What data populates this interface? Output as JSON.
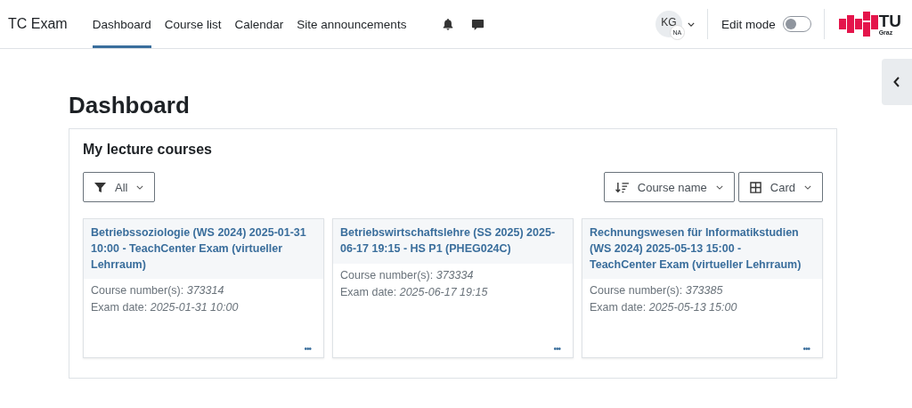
{
  "site_name": "TC Exam",
  "nav": [
    {
      "label": "Dashboard",
      "selected": true
    },
    {
      "label": "Course list",
      "selected": false
    },
    {
      "label": "Calendar",
      "selected": false
    },
    {
      "label": "Site announcements",
      "selected": false
    }
  ],
  "user": {
    "initials": "KG",
    "badge": "NA"
  },
  "edit_mode": {
    "label": "Edit mode",
    "on": false
  },
  "logo": {
    "text": "TU",
    "subtext": "Graz"
  },
  "page_title": "Dashboard",
  "block": {
    "title": "My lecture courses",
    "filter": "All",
    "sort": "Course name",
    "view": "Card",
    "courses": [
      {
        "title": "Betriebssoziologie (WS 2024) 2025-01-31 10:00 - TeachCenter Exam (virtueller Lehrraum)",
        "number": "Course number(s): *373314*",
        "date": "Exam date: *2025-01-31 10:00*",
        "menu": "•••"
      },
      {
        "title": "Betriebswirtschaftslehre (SS 2025) 2025-06-17 19:15 - HS P1 (PHEG024C)",
        "number": "Course number(s): *373334*",
        "date": "Exam date: *2025-06-17 19:15*",
        "menu": "•••"
      },
      {
        "title": "Rechnungswesen für Informatikstudien (WS 2024) 2025-05-13 15:00 - TeachCenter Exam (virtueller Lehrraum)",
        "number": "Course number(s): *373385*",
        "date": "Exam date: *2025-05-13 15:00*",
        "menu": "•••"
      }
    ]
  }
}
